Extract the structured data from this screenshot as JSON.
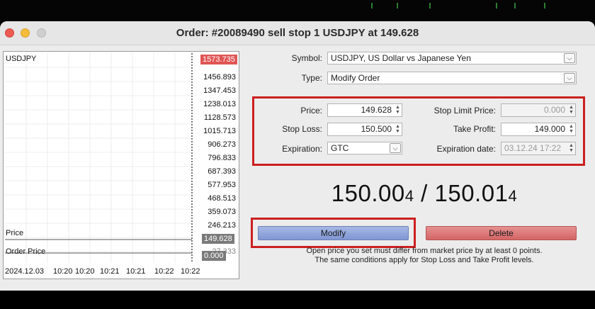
{
  "window": {
    "title": "Order: #20089490 sell stop 1 USDJPY at 149.628"
  },
  "chart": {
    "symbol_label": "USDJPY",
    "current_price_badge": "1573.735",
    "price_levels": [
      "1456.893",
      "1347.453",
      "1238.013",
      "1128.573",
      "1015.713",
      "906.273",
      "796.833",
      "687.393",
      "577.953",
      "468.513",
      "359.073",
      "246.213"
    ],
    "price_line_label": "Price",
    "price_line_value": "149.628",
    "order_price_label": "Order Price",
    "order_price_value": "0.000",
    "low_label": "27.333",
    "x_labels": [
      "2024.12.03",
      "10:20",
      "10:20",
      "10:21",
      "10:21",
      "10:22",
      "10:22"
    ]
  },
  "form": {
    "symbol_label": "Symbol:",
    "symbol_value": "USDJPY, US Dollar vs Japanese Yen",
    "type_label": "Type:",
    "type_value": "Modify Order",
    "price_label": "Price:",
    "price_value": "149.628",
    "stop_limit_label": "Stop Limit Price:",
    "stop_limit_value": "0.000",
    "stop_loss_label": "Stop Loss:",
    "stop_loss_value": "150.500",
    "take_profit_label": "Take Profit:",
    "take_profit_value": "149.000",
    "expiration_label": "Expiration:",
    "expiration_value": "GTC",
    "expiration_date_label": "Expiration date:",
    "expiration_date_value": "03.12.24 17:22"
  },
  "quote": {
    "bid_main": "150.00",
    "bid_small": "4",
    "sep": " / ",
    "ask_main": "150.01",
    "ask_small": "4"
  },
  "buttons": {
    "modify": "Modify",
    "delete": "Delete"
  },
  "notes": {
    "line1": "Open price you set must differ from market price by at least 0 points.",
    "line2": "The same conditions apply for Stop Loss and Take Profit levels."
  },
  "colors": {
    "highlight": "#cc1f1f",
    "modify_button": "#8ea2dc",
    "delete_button": "#dc7474",
    "price_badge": "#e05555"
  }
}
